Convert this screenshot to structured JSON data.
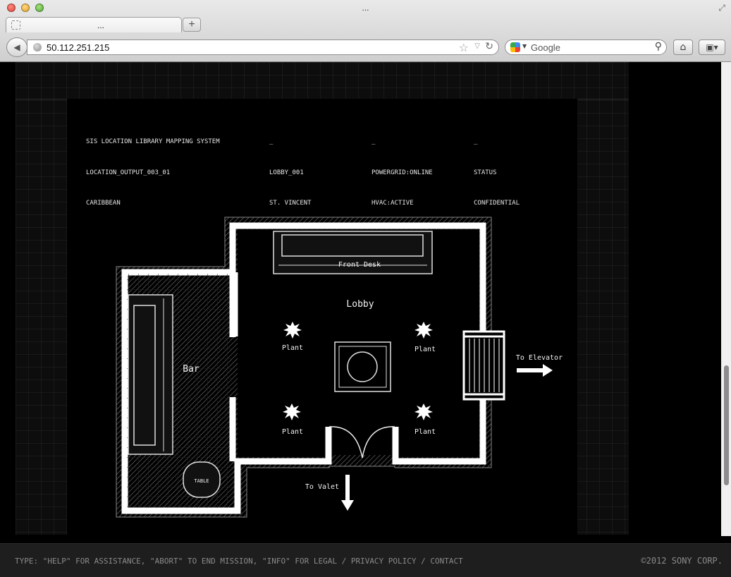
{
  "browser": {
    "window_title": "...",
    "tab_title": "...",
    "new_tab_label": "+",
    "url": "50.112.251.215",
    "search_placeholder": "Google"
  },
  "header": {
    "col1": [
      "SIS LOCATION LIBRARY MAPPING SYSTEM",
      "LOCATION_OUTPUT_003_01",
      "CARIBBEAN"
    ],
    "col2": [
      "_",
      "LOBBY_001",
      "ST. VINCENT"
    ],
    "col3": [
      "_",
      "POWERGRID:ONLINE",
      "HVAC:ACTIVE"
    ],
    "col4": [
      "_",
      "STATUS",
      "CONFIDENTIAL"
    ]
  },
  "map": {
    "front_desk": "Front Desk",
    "lobby": "Lobby",
    "bar": "Bar",
    "table": "TABLE",
    "plant_nw": "Plant",
    "plant_ne": "Plant",
    "plant_sw": "Plant",
    "plant_se": "Plant",
    "to_elevator": "To Elevator",
    "to_valet": "To Valet"
  },
  "footer": {
    "command_help": "TYPE: \"HELP\" FOR ASSISTANCE, \"ABORT\" TO END MISSION, \"INFO\" FOR LEGAL / PRIVACY POLICY / CONTACT",
    "copyright": "©2012 SONY CORP."
  },
  "colors": {
    "wall": "#ffffff",
    "background": "#000000",
    "grid": "#0d0d0d",
    "footer": "#1e1e1e"
  }
}
